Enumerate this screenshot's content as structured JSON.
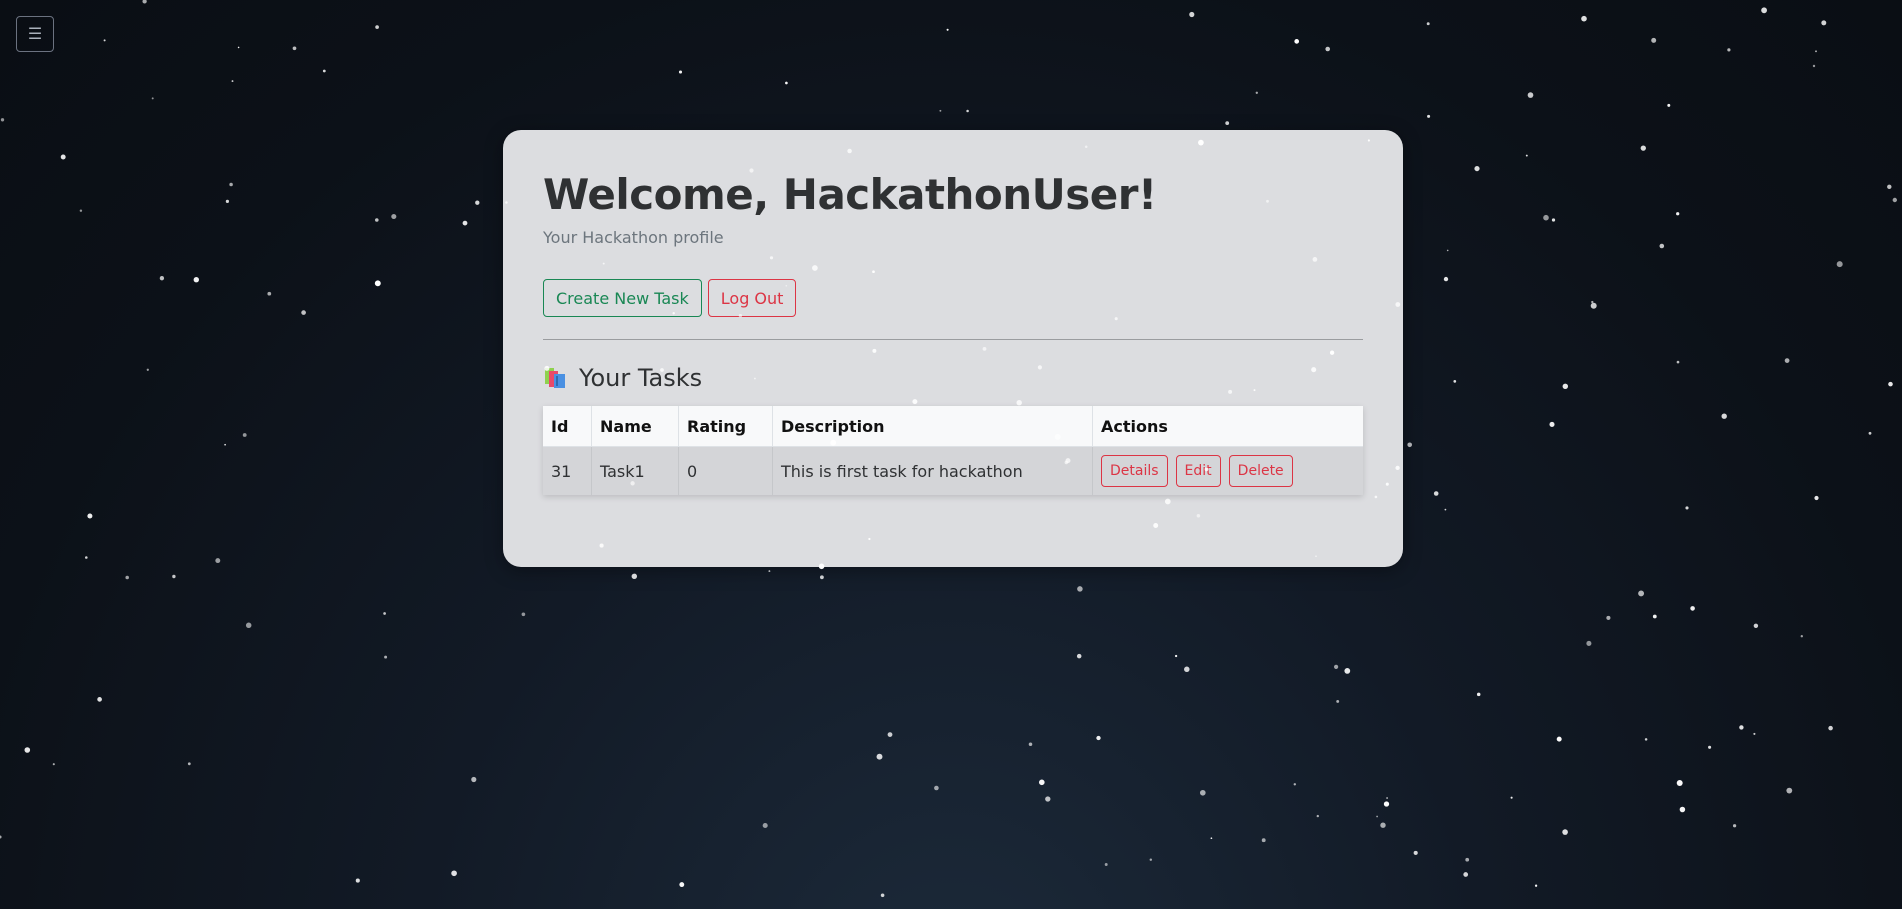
{
  "nav": {
    "menu_icon": "☰"
  },
  "profile": {
    "title": "Welcome, HackathonUser!",
    "subtitle": "Your Hackathon profile"
  },
  "buttons": {
    "create_task": "Create New Task",
    "log_out": "Log Out"
  },
  "tasks": {
    "heading": "Your Tasks",
    "heading_icon": "books-icon",
    "columns": [
      "Id",
      "Name",
      "Rating",
      "Description",
      "Actions"
    ],
    "rows": [
      {
        "id": "31",
        "name": "Task1",
        "rating": "0",
        "description": "This is first task for hackathon",
        "actions": [
          "Details",
          "Edit",
          "Delete"
        ]
      }
    ]
  },
  "colors": {
    "success": "#198754",
    "danger": "#dc3545",
    "card_bg": "#dcdde0",
    "page_bg": "#0c1118"
  }
}
